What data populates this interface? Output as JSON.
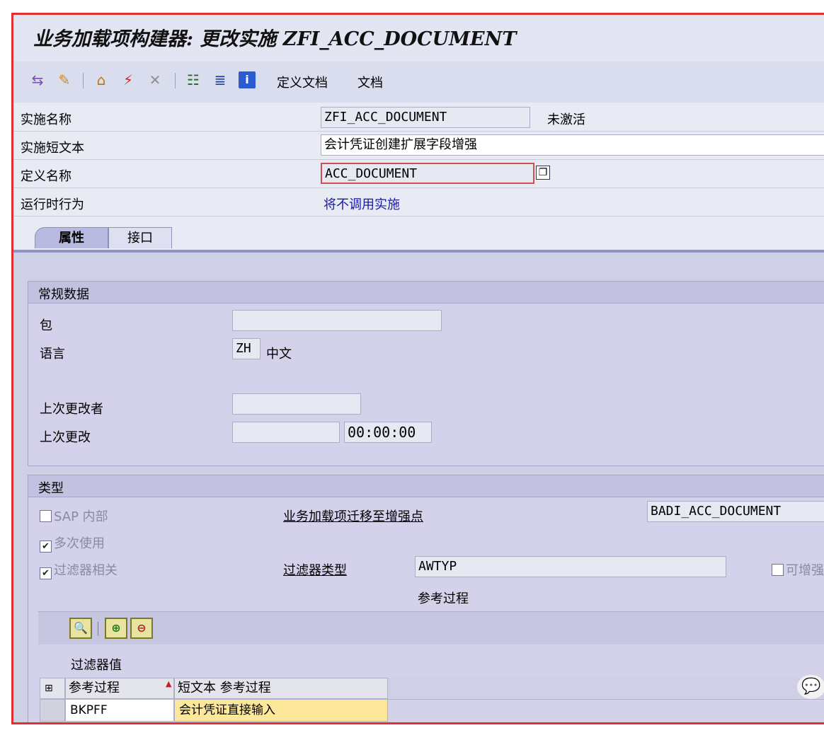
{
  "window": {
    "title": "业务加载项构建器: 更改实施 ZFI_ACC_DOCUMENT"
  },
  "toolbar": {
    "icons": [
      "other-object-icon",
      "display-change-icon",
      "hierarchy-icon",
      "activate-wand-icon",
      "deactivate-wand-icon",
      "structure-icon",
      "list-icon",
      "info-icon"
    ],
    "define_doc_label": "定义文档",
    "doc_label": "文档"
  },
  "header": {
    "impl_name_label": "实施名称",
    "impl_name_value": "ZFI_ACC_DOCUMENT",
    "status": "未激活",
    "short_text_label": "实施短文本",
    "short_text_value": "会计凭证创建扩展字段增强",
    "def_name_label": "定义名称",
    "def_name_value": "ACC_DOCUMENT",
    "runtime_label": "运行时行为",
    "runtime_value": "将不调用实施"
  },
  "tabs": [
    {
      "label": "属性",
      "active": true
    },
    {
      "label": "接口",
      "active": false
    }
  ],
  "general": {
    "title": "常规数据",
    "package_label": "包",
    "package_value": "",
    "language_label": "语言",
    "language_code": "ZH",
    "language_name": "中文",
    "last_changed_by_label": "上次更改者",
    "last_changed_by_value": "",
    "last_changed_label": "上次更改",
    "last_changed_date": "",
    "last_changed_time": "00:00:00"
  },
  "type": {
    "title": "类型",
    "sap_internal_label": "SAP 内部",
    "sap_internal_checked": false,
    "multiple_use_label": "多次使用",
    "multiple_use_checked": true,
    "filter_dependent_label": "过滤器相关",
    "filter_dependent_checked": true,
    "migrated_label": "业务加载项迁移至增强点",
    "migrated_value": "BADI_ACC_DOCUMENT",
    "filter_type_label": "过滤器类型",
    "filter_type_value": "AWTYP",
    "filter_type_desc": "参考过程",
    "extensible_label": "可增强",
    "extensible_checked": false,
    "filter_values_title": "过滤器值",
    "table": {
      "columns": [
        "参考过程",
        "短文本 参考过程"
      ],
      "rows": [
        {
          "code": "BKPFF",
          "text": "会计凭证直接输入"
        }
      ]
    }
  },
  "colors": {
    "accent": "#8f92c8",
    "frame": "#e03030",
    "highlight": "#fde79a",
    "link": "#1a1aa8"
  }
}
